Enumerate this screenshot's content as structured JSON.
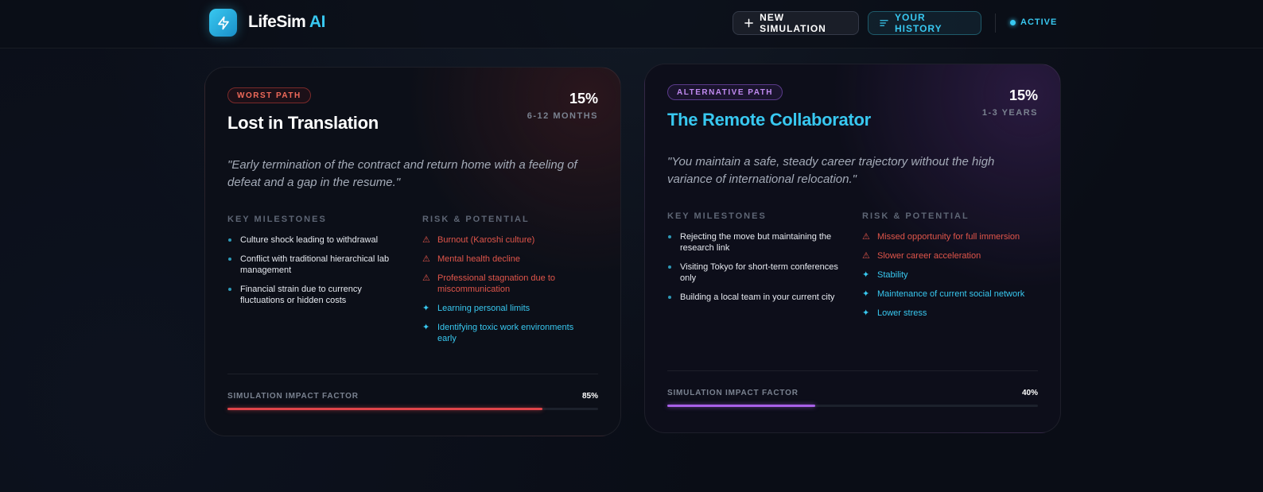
{
  "app": {
    "name_part1": "LifeSim",
    "name_part2": " AI",
    "logo_icon": "lightning-bolt-icon"
  },
  "toolbar": {
    "new_simulation_label": "NEW SIMULATION",
    "history_label": "YOUR HISTORY",
    "status_label": "ACTIVE"
  },
  "colors": {
    "accent": "#38c8f0",
    "worst": "#e0454a",
    "alternative": "#a860e8"
  },
  "cards": [
    {
      "badge": "WORST PATH",
      "probability": "15%",
      "duration": "6-12 MONTHS",
      "title": "Lost in Translation",
      "quote": "\"Early termination of the contract and return home with a feeling of defeat and a gap in the resume.\"",
      "milestones_label": "KEY MILESTONES",
      "milestones": [
        "Culture shock leading to withdrawal",
        "Conflict with traditional hierarchical lab management",
        "Financial strain due to currency fluctuations or hidden costs"
      ],
      "risks_label": "RISK & POTENTIAL",
      "risks": [
        {
          "type": "negative",
          "icon": "warning-icon",
          "text": "Burnout (Karoshi culture)"
        },
        {
          "type": "negative",
          "icon": "warning-icon",
          "text": "Mental health decline"
        },
        {
          "type": "negative",
          "icon": "warning-icon",
          "text": "Professional stagnation due to miscommunication"
        },
        {
          "type": "positive",
          "icon": "sparkle-icon",
          "text": "Learning personal limits"
        },
        {
          "type": "positive",
          "icon": "sparkle-icon",
          "text": "Identifying toxic work environments early"
        }
      ],
      "impact_label": "SIMULATION IMPACT FACTOR",
      "impact_value": "85%",
      "impact_fraction": 0.85
    },
    {
      "badge": "ALTERNATIVE PATH",
      "probability": "15%",
      "duration": "1-3 YEARS",
      "title": "The Remote Collaborator",
      "quote": "\"You maintain a safe, steady career trajectory without the high variance of international relocation.\"",
      "milestones_label": "KEY MILESTONES",
      "milestones": [
        "Rejecting the move but maintaining the research link",
        "Visiting Tokyo for short-term conferences only",
        "Building a local team in your current city"
      ],
      "risks_label": "RISK & POTENTIAL",
      "risks": [
        {
          "type": "negative",
          "icon": "warning-icon",
          "text": "Missed opportunity for full immersion"
        },
        {
          "type": "negative",
          "icon": "warning-icon",
          "text": "Slower career acceleration"
        },
        {
          "type": "positive",
          "icon": "sparkle-icon",
          "text": "Stability"
        },
        {
          "type": "positive",
          "icon": "sparkle-icon",
          "text": "Maintenance of current social network"
        },
        {
          "type": "positive",
          "icon": "sparkle-icon",
          "text": "Lower stress"
        }
      ],
      "impact_label": "SIMULATION IMPACT FACTOR",
      "impact_value": "40%",
      "impact_fraction": 0.4
    }
  ]
}
